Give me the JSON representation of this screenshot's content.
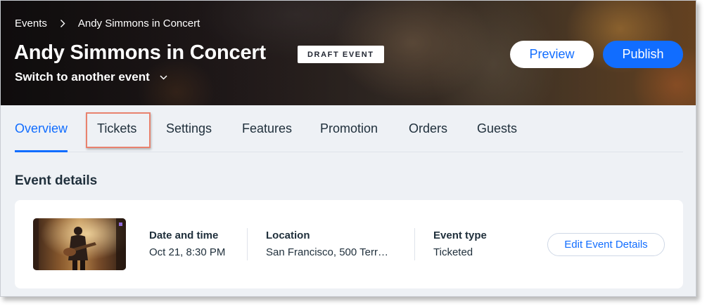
{
  "breadcrumb": {
    "root": "Events",
    "current": "Andy Simmons in Concert"
  },
  "header": {
    "title": "Andy Simmons in Concert",
    "badge": "DRAFT EVENT",
    "switch_label": "Switch to another event",
    "preview_label": "Preview",
    "publish_label": "Publish"
  },
  "tabs": [
    {
      "label": "Overview",
      "active": true
    },
    {
      "label": "Tickets",
      "active": false
    },
    {
      "label": "Settings",
      "active": false
    },
    {
      "label": "Features",
      "active": false
    },
    {
      "label": "Promotion",
      "active": false
    },
    {
      "label": "Orders",
      "active": false
    },
    {
      "label": "Guests",
      "active": false
    }
  ],
  "event_details": {
    "title": "Event details",
    "date_label": "Date and time",
    "date_value": "Oct 21, 8:30 PM",
    "location_label": "Location",
    "location_value": "San Francisco, 500 Terr…",
    "type_label": "Event type",
    "type_value": "Ticketed",
    "edit_label": "Edit Event Details"
  },
  "colors": {
    "accent": "#116dff",
    "highlight": "#e9826e",
    "text": "#20303c",
    "background": "#eef1f5"
  },
  "icons": {
    "breadcrumb_separator": "chevron-right-icon",
    "switch_event": "chevron-down-icon"
  }
}
